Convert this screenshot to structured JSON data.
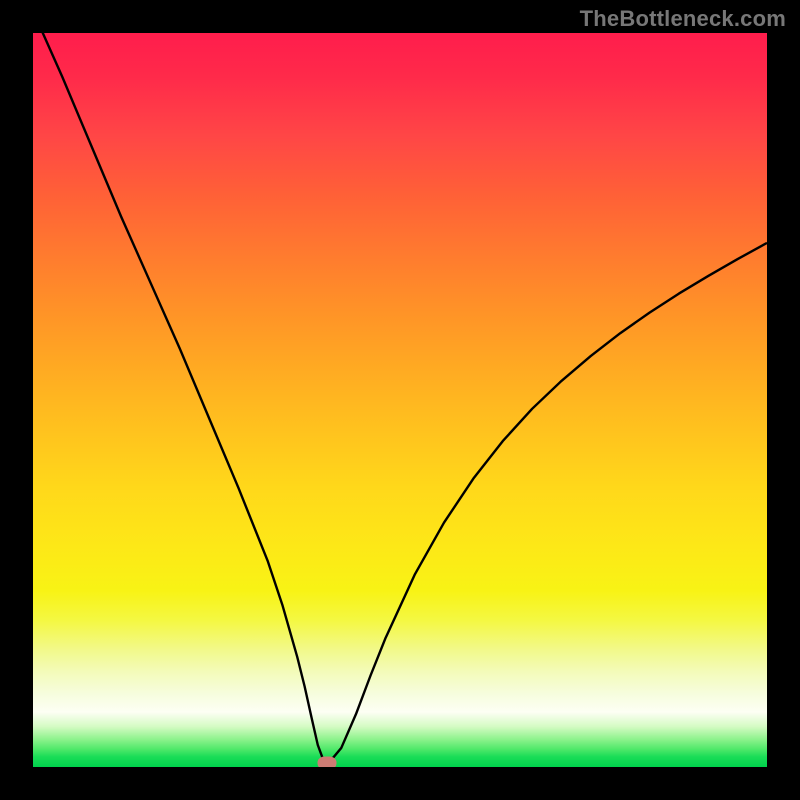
{
  "watermark": "TheBottleneck.com",
  "colors": {
    "frame_bg": "#000000",
    "curve": "#000000",
    "marker": "#cd7c74",
    "gradient_top": "#ff1d4c",
    "gradient_bottom": "#00d24d"
  },
  "chart_data": {
    "type": "line",
    "title": "",
    "xlabel": "",
    "ylabel": "",
    "xlim": [
      0,
      100
    ],
    "ylim": [
      0,
      100
    ],
    "grid": false,
    "legend": false,
    "x": [
      0,
      4,
      8,
      12,
      16,
      20,
      24,
      28,
      32,
      34,
      36,
      37,
      38,
      38.8,
      39.5,
      40.5,
      42,
      44,
      46,
      48,
      52,
      56,
      60,
      64,
      68,
      72,
      76,
      80,
      84,
      88,
      92,
      96,
      100
    ],
    "values": [
      103,
      94,
      84.5,
      75,
      66,
      57,
      47.5,
      38,
      28,
      22,
      15,
      11,
      6.5,
      3,
      1.1,
      0.8,
      2.6,
      7.2,
      12.5,
      17.5,
      26.2,
      33.3,
      39.3,
      44.4,
      48.8,
      52.6,
      56,
      59.1,
      61.9,
      64.5,
      66.9,
      69.2,
      71.4
    ],
    "marker": {
      "x": 40.1,
      "y": 0.5
    },
    "notes": "V-shaped bottleneck curve. x-axis is an unlabeled percentage scale; y-axis magnitude maps visually to a red-to-green gradient (high=red/bad, low=green/good). Minimum (optimal pairing) occurs near x≈40, y≈0. Values are estimated from pixel positions; no explicit tick labels are shown in the source image."
  }
}
